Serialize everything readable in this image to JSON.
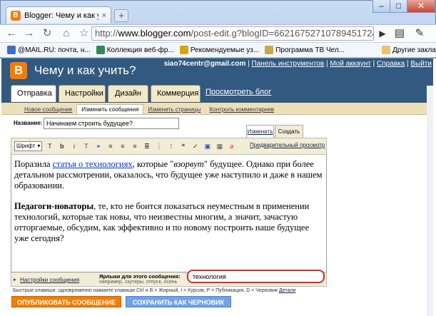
{
  "browser": {
    "tab_title": "Blogger: Чему и как учи...",
    "tab_close": "×",
    "new_tab": "+",
    "url_prefix": "http://",
    "url_host": "www.blogger.com",
    "url_path": "/post-edit.g?blogID=6621675271078945172&postID",
    "bookmarks": [
      "@MAIL.RU: почта, н...",
      "Коллекция веб-фр...",
      "Рекомендуемые уз...",
      "Программа ТВ Чел..."
    ],
    "other_bookmarks": "Другие закладки",
    "colors": {
      "bm1": "#3a6fc4",
      "bm2": "#2e8b57",
      "bm3": "#d9a316",
      "bm4": "#c7a74a"
    }
  },
  "header": {
    "blog_title": "Чему и как учить?",
    "user": "siao74centr@gmail.com",
    "links": [
      "Панель инструментов",
      "Мой аккаунт",
      "Справка",
      "Выйти"
    ],
    "sep": "|"
  },
  "tabs": {
    "main": [
      "Отправка",
      "Настройки",
      "Дизайн",
      "Коммерция"
    ],
    "view_blog": "Просмотреть блог",
    "sub": [
      "Новое сообщение",
      "Изменить сообщения",
      "Изменить страницы",
      "Контроль комментариев"
    ]
  },
  "editor": {
    "title_label": "Название:",
    "title_value": "Начинаем строить будущее?",
    "html_tab": "Изменить Html",
    "create_tab": "Создать",
    "font_label": "Шрифт",
    "preview": "Предварительный просмотр",
    "p1_a": "Поразила ",
    "p1_link": "статья о технологиях",
    "p1_b": ", которые \"",
    "p1_em": "взорвут",
    "p1_c": "\" будущее. Однако при более детальном рассмотрении, оказалось, что будущее уже наступило и даже в нашем образовании.",
    "p2_bold": "Педагоги-новаторы",
    "p2_rest": ", те, кто не боится показаться неуместным в применении технологий, которые так новы, что неизвестны многим, а значит, зачастую отторгаемые, обсудим, как эффективно и по новому построить наше будущее уже сегодня?"
  },
  "footer": {
    "settings_link": "Настройки сообщения",
    "labels_label": "Ярлыки для этого сообщения:",
    "labels_example": "например, скутеры, отпуск, осень",
    "labels_value": "технология",
    "shortcuts": "Быстрые клавиши: одновременно нажмите клавиши Ctrl и B = Жирный, I = Курсив, P = Публикация, D = Черновик",
    "details": "Детали",
    "publish": "ОПУБЛИКОВАТЬ СООБЩЕНИЕ",
    "save": "СОХРАНИТЬ КАК ЧЕРНОВИК"
  },
  "icons": [
    "blogger-icon",
    "back-icon",
    "forward-icon",
    "reload-icon",
    "home-icon",
    "star-icon",
    "play-icon",
    "page-icon",
    "wrench-icon",
    "folder-icon"
  ]
}
